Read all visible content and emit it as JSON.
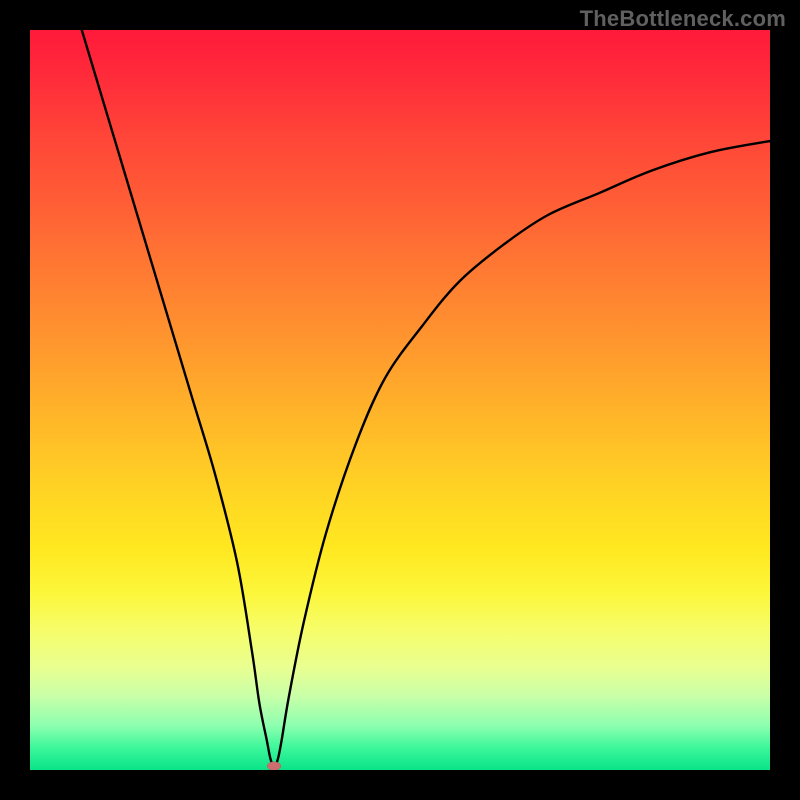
{
  "watermark": "TheBottleneck.com",
  "chart_data": {
    "type": "line",
    "title": "",
    "xlabel": "",
    "ylabel": "",
    "xlim": [
      0,
      100
    ],
    "ylim": [
      0,
      100
    ],
    "grid": false,
    "legend": false,
    "background": "rainbow-vertical-gradient (red top to green bottom)",
    "series": [
      {
        "name": "bottleneck-curve",
        "color": "#000000",
        "x": [
          7,
          10,
          13,
          16,
          19,
          22,
          25,
          28,
          30,
          31,
          32,
          32.5,
          33,
          33.5,
          34,
          35,
          37,
          40,
          44,
          48,
          53,
          58,
          64,
          70,
          77,
          84,
          92,
          100
        ],
        "y": [
          100,
          90,
          80,
          70,
          60,
          50,
          40,
          28,
          16,
          9,
          4,
          1.5,
          0.5,
          1.5,
          4,
          10,
          20,
          32,
          44,
          53,
          60,
          66,
          71,
          75,
          78,
          81,
          83.5,
          85
        ]
      }
    ],
    "marker": {
      "name": "optimal-point",
      "x": 33,
      "y": 0.5,
      "color": "#cd6e6e"
    }
  },
  "colors": {
    "frame": "#000000",
    "watermark": "#606060",
    "curve": "#000000",
    "marker": "#cd6e6e"
  }
}
